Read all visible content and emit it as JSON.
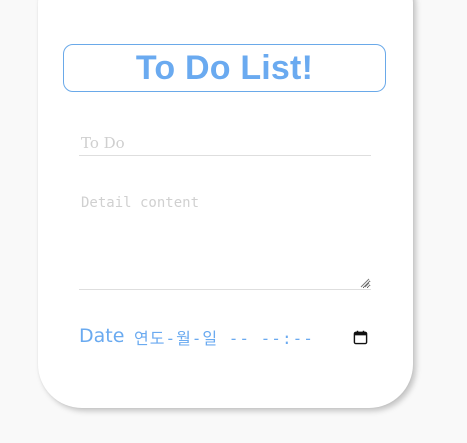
{
  "header": {
    "title": "To Do List!"
  },
  "form": {
    "todo_placeholder": "To Do",
    "todo_value": "",
    "detail_placeholder": "Detail content",
    "detail_value": "",
    "date_label": "Date",
    "date_display": "연도-월-일 -- --:--",
    "date_value": ""
  },
  "icons": {
    "calendar": "calendar-icon",
    "resize": "resize-grip-icon"
  },
  "colors": {
    "accent": "#6aaaf0",
    "border": "#6aa9e9",
    "background": "#f9f9f9",
    "card": "#ffffff"
  }
}
